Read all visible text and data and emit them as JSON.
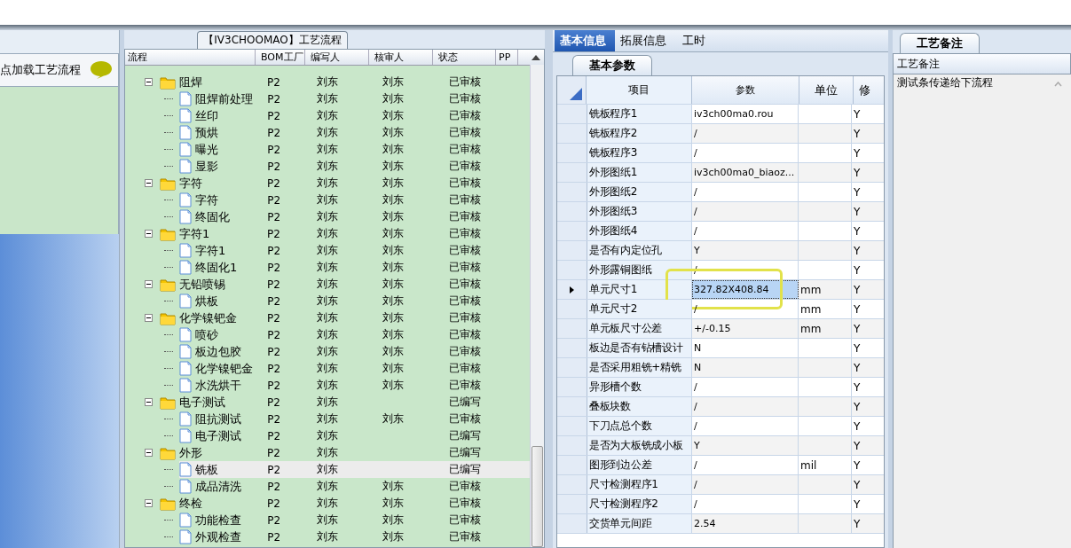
{
  "left_panel": {
    "hint": "点加载工艺流程"
  },
  "flow_panel": {
    "title": "【IV3CHOOMAO】工艺流程",
    "columns": [
      "流程",
      "BOM工厂",
      "编写人",
      "核审人",
      "状态",
      "PP"
    ],
    "tree": [
      {
        "name": "阻焊",
        "bom": "P2",
        "writer": "刘东",
        "reviewer": "刘东",
        "status": "已审核",
        "expanded": true,
        "selected": false,
        "children": [
          {
            "name": "阻焊前处理",
            "bom": "P2",
            "writer": "刘东",
            "reviewer": "刘东",
            "status": "已审核",
            "selected": false
          },
          {
            "name": "丝印",
            "bom": "P2",
            "writer": "刘东",
            "reviewer": "刘东",
            "status": "已审核",
            "selected": false
          },
          {
            "name": "预烘",
            "bom": "P2",
            "writer": "刘东",
            "reviewer": "刘东",
            "status": "已审核",
            "selected": false
          },
          {
            "name": "曝光",
            "bom": "P2",
            "writer": "刘东",
            "reviewer": "刘东",
            "status": "已审核",
            "selected": false
          },
          {
            "name": "显影",
            "bom": "P2",
            "writer": "刘东",
            "reviewer": "刘东",
            "status": "已审核",
            "selected": false
          }
        ]
      },
      {
        "name": "字符",
        "bom": "P2",
        "writer": "刘东",
        "reviewer": "刘东",
        "status": "已审核",
        "expanded": true,
        "selected": false,
        "children": [
          {
            "name": "字符",
            "bom": "P2",
            "writer": "刘东",
            "reviewer": "刘东",
            "status": "已审核",
            "selected": false
          },
          {
            "name": "终固化",
            "bom": "P2",
            "writer": "刘东",
            "reviewer": "刘东",
            "status": "已审核",
            "selected": false
          }
        ]
      },
      {
        "name": "字符1",
        "bom": "P2",
        "writer": "刘东",
        "reviewer": "刘东",
        "status": "已审核",
        "expanded": true,
        "selected": false,
        "children": [
          {
            "name": "字符1",
            "bom": "P2",
            "writer": "刘东",
            "reviewer": "刘东",
            "status": "已审核",
            "selected": false
          },
          {
            "name": "终固化1",
            "bom": "P2",
            "writer": "刘东",
            "reviewer": "刘东",
            "status": "已审核",
            "selected": false
          }
        ]
      },
      {
        "name": "无铅喷锡",
        "bom": "P2",
        "writer": "刘东",
        "reviewer": "刘东",
        "status": "已审核",
        "expanded": true,
        "selected": false,
        "children": [
          {
            "name": "烘板",
            "bom": "P2",
            "writer": "刘东",
            "reviewer": "刘东",
            "status": "已审核",
            "selected": false
          }
        ]
      },
      {
        "name": "化学镍钯金",
        "bom": "P2",
        "writer": "刘东",
        "reviewer": "刘东",
        "status": "已审核",
        "expanded": true,
        "selected": false,
        "children": [
          {
            "name": "喷砂",
            "bom": "P2",
            "writer": "刘东",
            "reviewer": "刘东",
            "status": "已审核",
            "selected": false
          },
          {
            "name": "板边包胶",
            "bom": "P2",
            "writer": "刘东",
            "reviewer": "刘东",
            "status": "已审核",
            "selected": false
          },
          {
            "name": "化学镍钯金",
            "bom": "P2",
            "writer": "刘东",
            "reviewer": "刘东",
            "status": "已审核",
            "selected": false
          },
          {
            "name": "水洗烘干",
            "bom": "P2",
            "writer": "刘东",
            "reviewer": "刘东",
            "status": "已审核",
            "selected": false
          }
        ]
      },
      {
        "name": "电子测试",
        "bom": "P2",
        "writer": "刘东",
        "status": "已编写",
        "expanded": true,
        "selected": false,
        "children": [
          {
            "name": "阻抗测试",
            "bom": "P2",
            "writer": "刘东",
            "reviewer": "刘东",
            "status": "已审核",
            "selected": false
          },
          {
            "name": "电子测试",
            "bom": "P2",
            "writer": "刘东",
            "status": "已编写",
            "selected": false
          }
        ]
      },
      {
        "name": "外形",
        "bom": "P2",
        "writer": "刘东",
        "status": "已编写",
        "expanded": true,
        "selected": false,
        "children": [
          {
            "name": "铣板",
            "bom": "P2",
            "writer": "刘东",
            "status": "已编写",
            "selected": true
          },
          {
            "name": "成品清洗",
            "bom": "P2",
            "writer": "刘东",
            "reviewer": "刘东",
            "status": "已审核",
            "selected": false
          }
        ]
      },
      {
        "name": "终检",
        "bom": "P2",
        "writer": "刘东",
        "reviewer": "刘东",
        "status": "已审核",
        "expanded": true,
        "selected": false,
        "children": [
          {
            "name": "功能检查",
            "bom": "P2",
            "writer": "刘东",
            "reviewer": "刘东",
            "status": "已审核",
            "selected": false
          },
          {
            "name": "外观检查",
            "bom": "P2",
            "writer": "刘东",
            "reviewer": "刘东",
            "status": "已审核",
            "selected": false
          }
        ]
      }
    ]
  },
  "detail_panel": {
    "tabs": [
      {
        "label": "基本信息",
        "selected": true
      },
      {
        "label": "拓展信息",
        "selected": false
      },
      {
        "label": "工时",
        "selected": false
      }
    ],
    "subtab": "基本参数",
    "columns": [
      "项目",
      "参数",
      "单位",
      "修"
    ],
    "rows": [
      {
        "item": "铣板程序1",
        "value": "iv3ch00ma0.rou",
        "modify": "Y",
        "selected": false
      },
      {
        "item": "铣板程序2",
        "value": "/",
        "modify": "Y",
        "selected": false
      },
      {
        "item": "铣板程序3",
        "value": "/",
        "modify": "Y",
        "selected": false
      },
      {
        "item": "外形图纸1",
        "value": "iv3ch00ma0_biaoz...",
        "modify": "Y",
        "selected": false
      },
      {
        "item": "外形图纸2",
        "value": "/",
        "modify": "Y",
        "selected": false
      },
      {
        "item": "外形图纸3",
        "value": "/",
        "modify": "Y",
        "selected": false
      },
      {
        "item": "外形图纸4",
        "value": "/",
        "modify": "Y",
        "selected": false
      },
      {
        "item": "是否有内定位孔",
        "value": "Y",
        "modify": "Y",
        "selected": false
      },
      {
        "item": "外形露铜图纸",
        "value": "/",
        "modify": "Y",
        "selected": false
      },
      {
        "item": "单元尺寸1",
        "value": "327.82X408.84",
        "unit": "mm",
        "modify": "Y",
        "selected": true
      },
      {
        "item": "单元尺寸2",
        "value": "/",
        "unit": "mm",
        "modify": "Y",
        "selected": false
      },
      {
        "item": "单元板尺寸公差",
        "value": "+/-0.15",
        "unit": "mm",
        "modify": "Y",
        "selected": false
      },
      {
        "item": "板边是否有钻槽设计",
        "value": "N",
        "modify": "Y",
        "selected": false
      },
      {
        "item": "是否采用粗铣+精铣",
        "value": "N",
        "modify": "Y",
        "selected": false
      },
      {
        "item": "异形槽个数",
        "value": "/",
        "modify": "Y",
        "selected": false
      },
      {
        "item": "叠板块数",
        "value": "/",
        "modify": "Y",
        "selected": false
      },
      {
        "item": "下刀点总个数",
        "value": "/",
        "modify": "Y",
        "selected": false
      },
      {
        "item": "是否为大板铣成小板",
        "value": "Y",
        "modify": "Y",
        "selected": false
      },
      {
        "item": "图形到边公差",
        "value": "/",
        "unit": "mil",
        "modify": "Y",
        "selected": false
      },
      {
        "item": "尺寸检测程序1",
        "value": "/",
        "modify": "Y",
        "selected": false
      },
      {
        "item": "尺寸检测程序2",
        "value": "/",
        "modify": "Y",
        "selected": false
      },
      {
        "item": "交货单元间距",
        "value": "2.54",
        "modify": "Y",
        "selected": false
      }
    ]
  },
  "notes_panel": {
    "tab": "工艺备注",
    "header": "工艺备注",
    "text": "测试条传递给下流程"
  }
}
